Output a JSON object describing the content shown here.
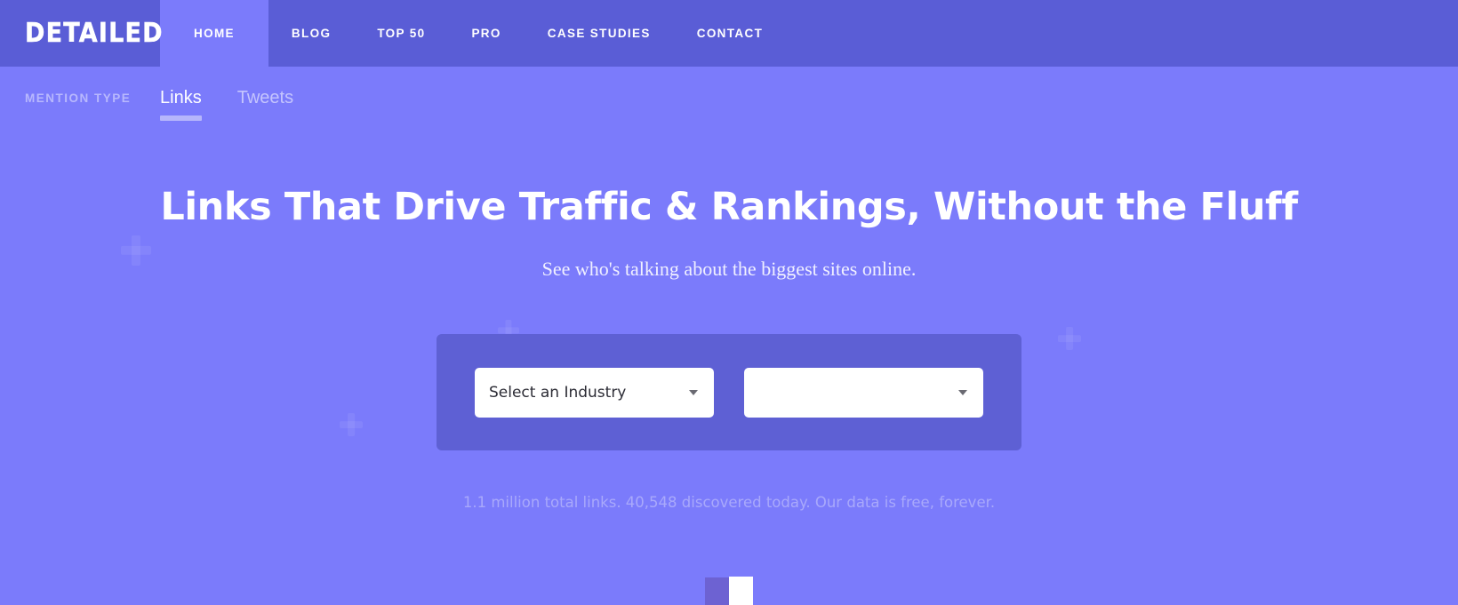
{
  "brand": {
    "name": "DETAILED"
  },
  "nav": {
    "items": [
      {
        "label": "HOME",
        "active": true
      },
      {
        "label": "BLOG",
        "active": false
      },
      {
        "label": "TOP 50",
        "active": false
      },
      {
        "label": "PRO",
        "active": false
      },
      {
        "label": "CASE STUDIES",
        "active": false
      },
      {
        "label": "CONTACT",
        "active": false
      }
    ]
  },
  "subnav": {
    "label": "MENTION TYPE",
    "tabs": [
      {
        "label": "Links",
        "active": true
      },
      {
        "label": "Tweets",
        "active": false
      }
    ]
  },
  "hero": {
    "title": "Links That Drive Traffic & Rankings, Without the Fluff",
    "subtitle": "See who's talking about the biggest sites online."
  },
  "form": {
    "industry_select": {
      "value": "Select an Industry",
      "placeholder": "Select an Industry",
      "caret_icon": "chevron-down-icon"
    },
    "secondary_select": {
      "value": "",
      "placeholder": "",
      "caret_icon": "chevron-down-icon"
    }
  },
  "status": {
    "text": "1.1 million total links. 40,548 discovered today. Our data is free, forever.",
    "total_links": "1.1 million",
    "discovered_today": "40,548"
  },
  "pagination": {
    "pages": [
      {
        "label": "",
        "current": false
      },
      {
        "label": "",
        "current": true
      }
    ]
  },
  "colors": {
    "page_background": "#7b7bfb",
    "header_background": "#5a5dd6",
    "panel_background": "#5e60d4",
    "accent_white": "#ffffff",
    "muted_text": "#a9a9fb",
    "subnav_label": "#b8b8fd"
  }
}
